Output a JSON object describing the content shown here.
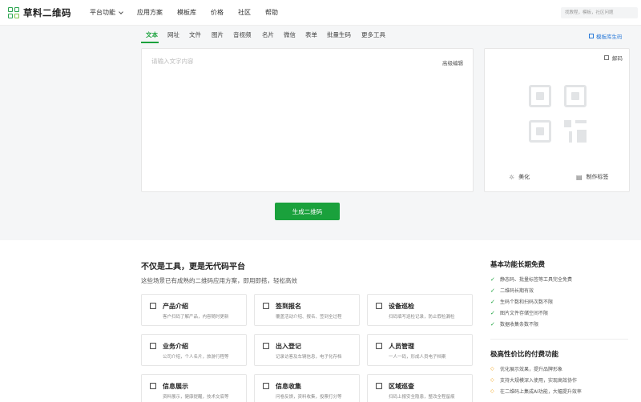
{
  "brand": {
    "name": "草料二维码"
  },
  "nav": [
    "平台功能",
    "应用方案",
    "模板库",
    "价格",
    "社区",
    "帮助"
  ],
  "search": {
    "placeholder": "找教程，模板，社区问题"
  },
  "tabs": [
    "文本",
    "网址",
    "文件",
    "图片",
    "音视频",
    "名片",
    "微信",
    "表单",
    "批量生码",
    "更多工具"
  ],
  "template_link": "模板库生码",
  "editor": {
    "placeholder": "请输入文字内容",
    "advanced": "高级编辑"
  },
  "preview": {
    "decode": "解码",
    "beautify": "美化",
    "make_label": "制作标签"
  },
  "generate_button": "生成二维码",
  "lower": {
    "title": "不仅是工具，更是无代码平台",
    "subtitle": "这些场景已有成熟的二维码应用方案，即用即搭，轻松高效"
  },
  "cards": [
    {
      "title": "产品介绍",
      "desc": "客户扫码了解产品，内容随时更新"
    },
    {
      "title": "签到报名",
      "desc": "覆盖活动介绍、报名、签到全过程"
    },
    {
      "title": "设备巡检",
      "desc": "扫码填写巡检记录，防止假检漏检"
    },
    {
      "title": "业务介绍",
      "desc": "公司介绍，个人名片，旅游行程等"
    },
    {
      "title": "出入登记",
      "desc": "记录访客及车辆信息，电子化存档"
    },
    {
      "title": "人员管理",
      "desc": "一人一码，形成人员电子档案"
    },
    {
      "title": "信息展示",
      "desc": "资料展示，健康提醒，技术交底等"
    },
    {
      "title": "信息收集",
      "desc": "问卷反馈，资料收集，投票打分等"
    },
    {
      "title": "区域巡查",
      "desc": "扫码上报安全隐患，整改全程留痕"
    }
  ],
  "free_features": {
    "title": "基本功能长期免费",
    "items": [
      "静态码、批量标签等工具完全免费",
      "二维码长期有效",
      "生码个数和扫码次数不限",
      "图片文件存储空间不限",
      "数据收集条数不限"
    ]
  },
  "paid_features": {
    "title": "极高性价比的付费功能",
    "items": [
      "优化展示效果，提升品牌形象",
      "支持大规模深入使用，实现高效协作",
      "在二维码上集成AI功能，大幅提升效率"
    ]
  },
  "colors": {
    "brand_green": "#1aa13c",
    "link_blue": "#2a7ad8",
    "paid_accent": "#f2a31b"
  }
}
